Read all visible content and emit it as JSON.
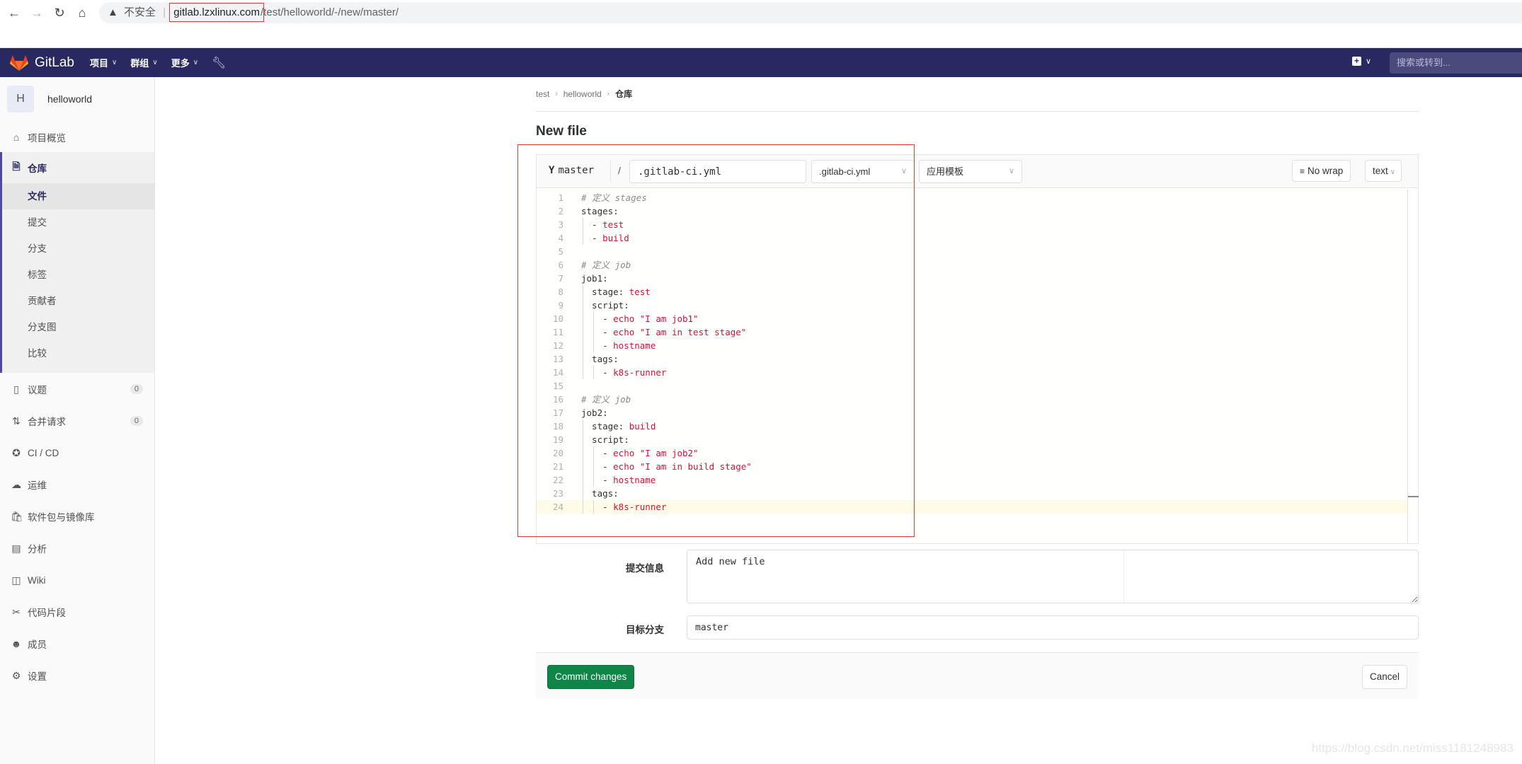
{
  "browser": {
    "insecure_label": "不安全",
    "url_host": "gitlab.lzxlinux.com",
    "url_path": "/test/helloworld/-/new/master/"
  },
  "navbar": {
    "brand": "GitLab",
    "menus": [
      {
        "label": "项目"
      },
      {
        "label": "群组"
      },
      {
        "label": "更多"
      }
    ],
    "search_placeholder": "搜索或转到..."
  },
  "sidebar": {
    "project_initial": "H",
    "project_name": "helloworld",
    "overview": "项目概览",
    "repository": {
      "label": "仓库",
      "items": [
        {
          "label": "文件",
          "active": true
        },
        {
          "label": "提交"
        },
        {
          "label": "分支"
        },
        {
          "label": "标签"
        },
        {
          "label": "贡献者"
        },
        {
          "label": "分支图"
        },
        {
          "label": "比较"
        }
      ]
    },
    "items": [
      {
        "label": "议题",
        "badge": "0",
        "icon": "issues-icon"
      },
      {
        "label": "合并请求",
        "badge": "0",
        "icon": "merge-request-icon"
      },
      {
        "label": "CI / CD",
        "icon": "rocket-icon"
      },
      {
        "label": "运维",
        "icon": "cloud-gear-icon"
      },
      {
        "label": "软件包与镜像库",
        "icon": "package-icon"
      },
      {
        "label": "分析",
        "icon": "chart-icon"
      },
      {
        "label": "Wiki",
        "icon": "book-icon"
      },
      {
        "label": "代码片段",
        "icon": "scissors-icon"
      },
      {
        "label": "成员",
        "icon": "users-icon"
      },
      {
        "label": "设置",
        "icon": "settings-icon"
      }
    ]
  },
  "breadcrumb": [
    "test",
    "helloworld",
    "仓库"
  ],
  "page_title": "New file",
  "editor": {
    "branch": "master",
    "path_separator": "/",
    "file_name": ".gitlab-ci.yml",
    "file_type_select": ".gitlab-ci.yml",
    "template_select": "应用模板",
    "no_wrap_label": "No wrap",
    "mode_select": "text",
    "active_line": 24,
    "lines": [
      [
        {
          "t": "c",
          "v": "# 定义 stages"
        }
      ],
      [
        {
          "t": "k",
          "v": "stages:"
        }
      ],
      [
        {
          "t": "k",
          "v": "  - "
        },
        {
          "t": "s",
          "v": "test"
        }
      ],
      [
        {
          "t": "k",
          "v": "  - "
        },
        {
          "t": "s",
          "v": "build"
        }
      ],
      [],
      [
        {
          "t": "c",
          "v": "# 定义 job"
        }
      ],
      [
        {
          "t": "k",
          "v": "job1:"
        }
      ],
      [
        {
          "t": "k",
          "v": "  stage: "
        },
        {
          "t": "s",
          "v": "test"
        }
      ],
      [
        {
          "t": "k",
          "v": "  script:"
        }
      ],
      [
        {
          "t": "k",
          "v": "    - "
        },
        {
          "t": "s",
          "v": "echo \"I am job1\""
        }
      ],
      [
        {
          "t": "k",
          "v": "    - "
        },
        {
          "t": "s",
          "v": "echo \"I am in test stage\""
        }
      ],
      [
        {
          "t": "k",
          "v": "    - "
        },
        {
          "t": "s",
          "v": "hostname"
        }
      ],
      [
        {
          "t": "k",
          "v": "  tags:"
        }
      ],
      [
        {
          "t": "k",
          "v": "    - "
        },
        {
          "t": "s",
          "v": "k8s-runner"
        }
      ],
      [],
      [
        {
          "t": "c",
          "v": "# 定义 job"
        }
      ],
      [
        {
          "t": "k",
          "v": "job2:"
        }
      ],
      [
        {
          "t": "k",
          "v": "  stage: "
        },
        {
          "t": "s",
          "v": "build"
        }
      ],
      [
        {
          "t": "k",
          "v": "  script:"
        }
      ],
      [
        {
          "t": "k",
          "v": "    - "
        },
        {
          "t": "s",
          "v": "echo \"I am job2\""
        }
      ],
      [
        {
          "t": "k",
          "v": "    - "
        },
        {
          "t": "s",
          "v": "echo \"I am in build stage\""
        }
      ],
      [
        {
          "t": "k",
          "v": "    - "
        },
        {
          "t": "s",
          "v": "hostname"
        }
      ],
      [
        {
          "t": "k",
          "v": "  tags:"
        }
      ],
      [
        {
          "t": "k",
          "v": "    - "
        },
        {
          "t": "s",
          "v": "k8s-runner"
        }
      ]
    ]
  },
  "commit_form": {
    "message_label": "提交信息",
    "message_value": "Add new file",
    "branch_label": "目标分支",
    "branch_value": "master",
    "commit_button": "Commit changes",
    "cancel_button": "Cancel"
  },
  "colors": {
    "navbar": "#292961",
    "commit_button": "#108548",
    "string_token": "#d6103a",
    "annotation_box": "#e03a3a"
  },
  "watermark": "https://blog.csdn.net/miss1181248983"
}
